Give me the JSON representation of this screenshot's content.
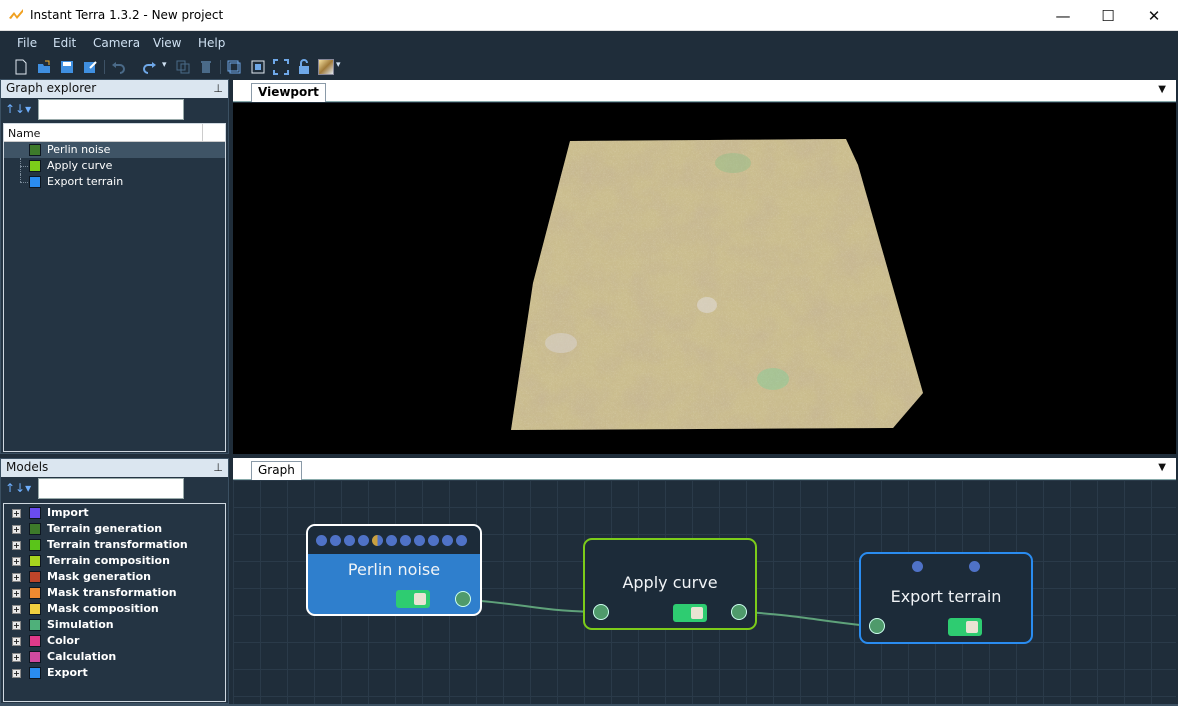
{
  "window": {
    "title": "Instant Terra 1.3.2 - New project",
    "controls": {
      "minimize": "—",
      "maximize": "☐",
      "close": "✕"
    }
  },
  "menu": [
    "File",
    "Edit",
    "Camera",
    "View",
    "Help"
  ],
  "toolbar": {
    "icons": [
      "new-file-icon",
      "open-file-icon",
      "save-icon",
      "save-as-icon",
      "undo-icon",
      "redo-icon",
      "copy-icon",
      "delete-icon",
      "frame-icon",
      "render-icon",
      "fit-view-icon",
      "lock-icon",
      "gradient-icon"
    ]
  },
  "graph_explorer": {
    "title": "Graph explorer",
    "pin": "📌",
    "sort": "↑↓▾",
    "search_placeholder": "",
    "column": "Name",
    "items": [
      {
        "label": "Perlin noise",
        "color": "#3d7a2a"
      },
      {
        "label": "Apply curve",
        "color": "#7ccc1a"
      },
      {
        "label": "Export terrain",
        "color": "#2a8cf0"
      }
    ]
  },
  "models": {
    "title": "Models",
    "pin": "📌",
    "sort": "↑↓▾",
    "search_placeholder": "",
    "expander": "+",
    "categories": [
      {
        "label": "Import",
        "color": "#6a4cf0"
      },
      {
        "label": "Terrain generation",
        "color": "#3d7a2a"
      },
      {
        "label": "Terrain transformation",
        "color": "#5ac41a"
      },
      {
        "label": "Terrain composition",
        "color": "#a6d41e"
      },
      {
        "label": "Mask generation",
        "color": "#c0452a"
      },
      {
        "label": "Mask transformation",
        "color": "#f08a30"
      },
      {
        "label": "Mask composition",
        "color": "#f0d040"
      },
      {
        "label": "Simulation",
        "color": "#4fb07a"
      },
      {
        "label": "Color",
        "color": "#e03a8a"
      },
      {
        "label": "Calculation",
        "color": "#d04aa0"
      },
      {
        "label": "Export",
        "color": "#2a8cf0"
      }
    ]
  },
  "viewport": {
    "tab": "Viewport",
    "dropdown": "▼"
  },
  "graph": {
    "tab": "Graph",
    "dropdown": "▼",
    "nodes": [
      {
        "title": "Perlin noise",
        "border": "#ffffff",
        "fill": "#2f7fcd",
        "param_dots": 12
      },
      {
        "title": "Apply curve",
        "border": "#7ccc1a",
        "fill": "#1c2b39",
        "param_dots": 0
      },
      {
        "title": "Export terrain",
        "border": "#2a8cf0",
        "fill": "#1c2b39",
        "param_dots": 2
      }
    ]
  }
}
